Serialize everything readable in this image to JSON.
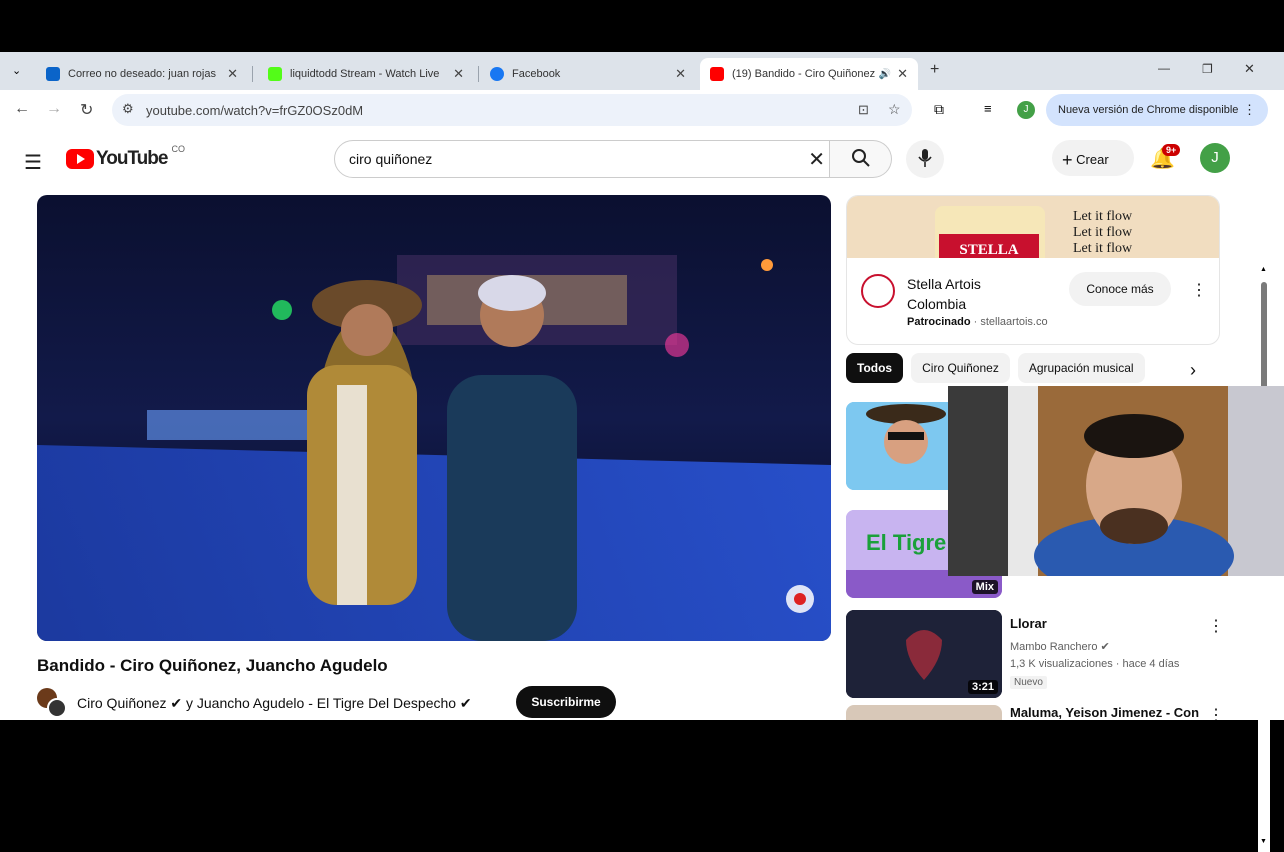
{
  "tabs": [
    {
      "title": "Correo no deseado: juan rojas",
      "close": "✕"
    },
    {
      "title": "liquidtodd Stream - Watch Live",
      "close": "✕"
    },
    {
      "title": "Facebook",
      "close": "✕"
    },
    {
      "title": "(19) Bandido - Ciro Quiñonez",
      "close": "✕"
    }
  ],
  "new_tab": "+",
  "window_controls": {
    "minimize": "—",
    "restore": "❐",
    "close": "✕"
  },
  "omnibox": {
    "url": "youtube.com/watch?v=frGZ0OSz0dM"
  },
  "chrome_update": "Nueva versión de Chrome disponible",
  "profile_initial": "J",
  "youtube": {
    "logo_text": "YouTube",
    "country": "CO",
    "search_value": "ciro quiñonez",
    "create_label": "Crear",
    "notifications_badge": "9+",
    "avatar_initial": "J"
  },
  "video": {
    "title": "Bandido - Ciro Quiñonez, Juancho Agudelo",
    "channels": "Ciro Quiñonez ✔ y Juancho Agudelo - El Tigre Del Despecho ✔",
    "subscribe_label": "Suscribirme"
  },
  "ad": {
    "banner_text": "Let it flow\nLet it flow\nLet it flow",
    "brand_line1": "Stella Artois",
    "brand_line2": "Colombia",
    "sponsored": "Patrocinado",
    "domain": "stellaartois.co",
    "cta": "Conoce más",
    "logo_text": "STELLA ARTOIS"
  },
  "chips": [
    "Todos",
    "Ciro Quiñonez",
    "Agrupación musical"
  ],
  "recommendations": [
    {
      "title": "",
      "channel": "",
      "stats": "",
      "duration": "",
      "new": ""
    },
    {
      "title": "",
      "channel": "",
      "stats": "",
      "duration": "Mix",
      "new": ""
    },
    {
      "title": "Llorar",
      "channel": "Mambo Ranchero ✔",
      "stats": "1,3 K visualizaciones · hace 4 días",
      "duration": "3:21",
      "new": "Nuevo"
    },
    {
      "title": "Maluma, Yeison Jimenez - Con",
      "channel": "",
      "stats": "",
      "duration": "",
      "new": ""
    }
  ],
  "colors": {
    "yt_red": "#ff0000",
    "chrome_bg": "#dde3ea",
    "avatar_green": "#43a047"
  }
}
